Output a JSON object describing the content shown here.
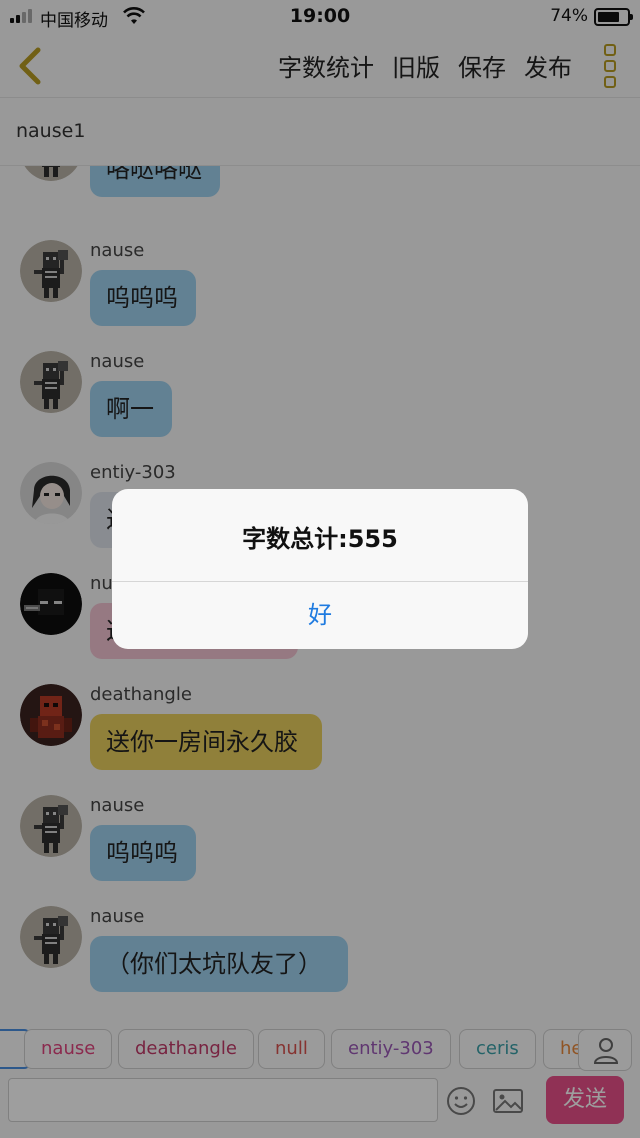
{
  "status_bar": {
    "carrier": "中国移动",
    "time": "19:00",
    "battery_percent": "74%",
    "battery_level": 0.74,
    "icons": [
      "signal-icon",
      "wifi-icon",
      "battery-icon"
    ]
  },
  "nav": {
    "back_icon": "chevron-left-icon",
    "actions": {
      "word_count": "字数统计",
      "old_version": "旧版",
      "save": "保存",
      "publish": "发布"
    },
    "more_icon": "more-vertical-icon",
    "accent_color": "#b79c22"
  },
  "room": {
    "name": "nause1"
  },
  "messages": [
    {
      "sender": "",
      "text": "咯哒咯哒",
      "bubble_color": "#9fd0ee",
      "avatar": "skeleton-avatar"
    },
    {
      "sender": "nause",
      "text": "呜呜呜",
      "bubble_color": "#9fd0ee",
      "avatar": "skeleton-avatar"
    },
    {
      "sender": "nause",
      "text": "啊一",
      "bubble_color": "#9fd0ee",
      "avatar": "skeleton-avatar"
    },
    {
      "sender": "entiy-303",
      "text": "过",
      "bubble_color": "#dde3ea",
      "avatar": "anime-avatar"
    },
    {
      "sender": "null",
      "text": "这",
      "bubble_color": "#f3c4d2",
      "avatar": "enderman-avatar"
    },
    {
      "sender": "deathangle",
      "text": "送你一房间永久胶",
      "bubble_color": "#e9cf5e",
      "avatar": "red-creature-avatar"
    },
    {
      "sender": "nause",
      "text": "呜呜呜",
      "bubble_color": "#9fd0ee",
      "avatar": "skeleton-avatar"
    },
    {
      "sender": "nause",
      "text": "（你们太坑队友了）",
      "bubble_color": "#9fd0ee",
      "avatar": "skeleton-avatar"
    }
  ],
  "alert": {
    "message": "字数总计:555",
    "ok_label": "好",
    "ok_color": "#1f7be0"
  },
  "user_chips": [
    {
      "name": "nause",
      "color": "#e0457f"
    },
    {
      "name": "deathangle",
      "color": "#c23a6a"
    },
    {
      "name": "null",
      "color": "#d9534f"
    },
    {
      "name": "entiy-303",
      "color": "#9b59b6"
    },
    {
      "name": "ceris",
      "color": "#3aa0a8"
    },
    {
      "name": "he",
      "color": "#e8883a"
    }
  ],
  "input": {
    "placeholder": "",
    "value": "",
    "send_label": "发送",
    "send_color": "#e8508a",
    "icons": [
      "emoji-icon",
      "image-icon",
      "user-profile-icon"
    ]
  }
}
